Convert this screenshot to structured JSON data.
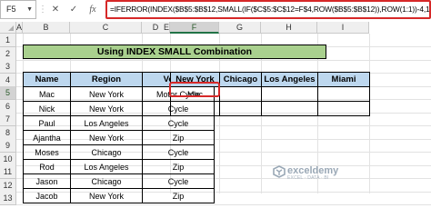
{
  "formula_bar": {
    "name_box": "F5",
    "cancel_glyph": "✕",
    "enter_glyph": "✓",
    "fx_label": "fx",
    "formula": "=IFERROR(INDEX($B$5:$B$12,SMALL(IF($C$5:$C$12=F$4,ROW($B$5:$B$12)),ROW(1:1))-4,1),\"\")"
  },
  "columns": [
    "A",
    "B",
    "C",
    "D",
    "E",
    "F",
    "G",
    "H",
    "I"
  ],
  "selected_column": "F",
  "rows": [
    "1",
    "2",
    "3",
    "4",
    "5",
    "6",
    "7",
    "8",
    "9",
    "10",
    "11",
    "12",
    "13"
  ],
  "selected_row": "5",
  "title": "Using INDEX SMALL Combination",
  "source_table": {
    "headers": [
      "Name",
      "Region",
      "Vehicle"
    ],
    "rows": [
      [
        "Mac",
        "New York",
        "Motor Cycle"
      ],
      [
        "Nick",
        "New York",
        "Cycle"
      ],
      [
        "Paul",
        "Los Angeles",
        "Cycle"
      ],
      [
        "Ajantha",
        "New York",
        "Zip"
      ],
      [
        "Moses",
        "Chicago",
        "Cycle"
      ],
      [
        "Rod",
        "Los Angeles",
        "Zip"
      ],
      [
        "Jason",
        "Chicago",
        "Cycle"
      ],
      [
        "Jacob",
        "New York",
        "Zip"
      ]
    ]
  },
  "result_table": {
    "headers": [
      "New York",
      "Chicago",
      "Los Angeles",
      "Miami"
    ],
    "rows": [
      [
        "Mac",
        "",
        "",
        ""
      ],
      [
        "",
        "",
        "",
        ""
      ]
    ]
  },
  "watermark": {
    "brand": "exceldemy",
    "tagline": "EXCEL · DATA · BI"
  },
  "colors": {
    "title_fill": "#a9d08e",
    "header_fill": "#bdd7ee",
    "highlight": "#d62828"
  }
}
